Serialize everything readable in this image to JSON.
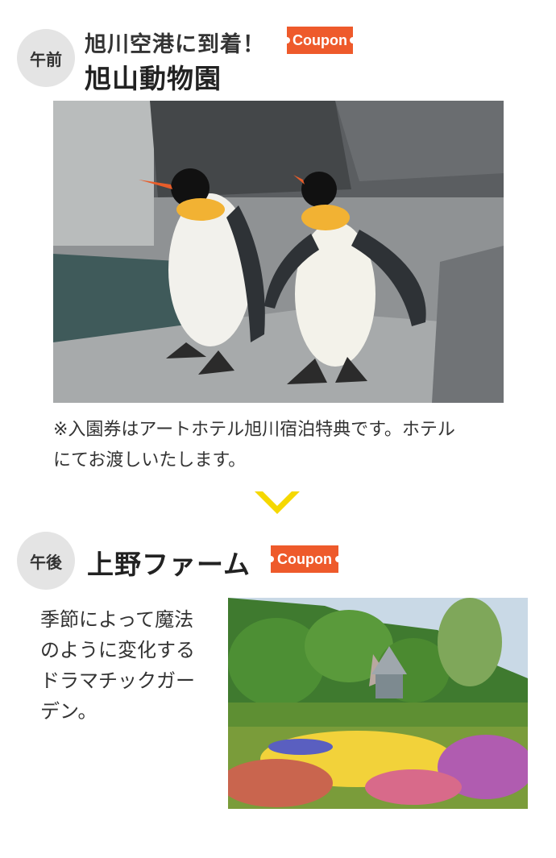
{
  "morning": {
    "time_label": "午前",
    "subtitle": "旭川空港に到着！",
    "coupon_label": "Coupon",
    "title": "旭山動物園",
    "note_line1": "※入園券はアートホテル旭川宿泊特典です。ホテル",
    "note_line2": "にてお渡しいたします。"
  },
  "divider_icon": "chevron-down-icon",
  "afternoon": {
    "time_label": "午後",
    "title": "上野ファーム",
    "coupon_label": "Coupon",
    "desc_line1": "季節によって魔法",
    "desc_line2": "のように変化する",
    "desc_line3": "ドラマチックガー",
    "desc_line4": "デン。"
  },
  "colors": {
    "coupon": "#ee5a2b",
    "chevron": "#f5d800",
    "circle": "#e4e4e4"
  }
}
